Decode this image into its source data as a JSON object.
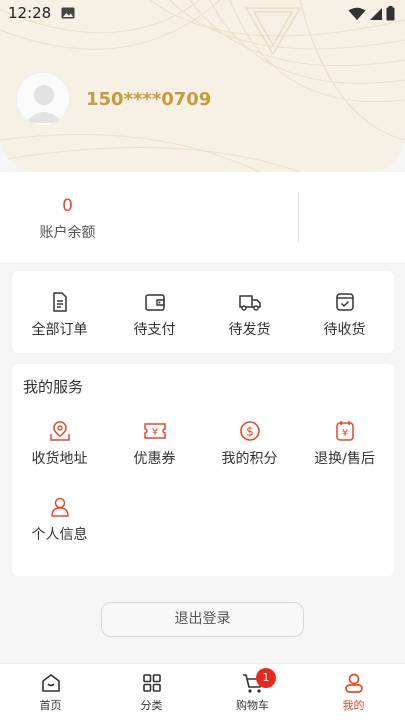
{
  "status_bar": {
    "time": "12:28"
  },
  "profile": {
    "phone": "150****0709"
  },
  "balance": {
    "value": "0",
    "label": "账户余额"
  },
  "orders": [
    {
      "label": "全部订单",
      "icon": "document-icon"
    },
    {
      "label": "待支付",
      "icon": "wallet-icon"
    },
    {
      "label": "待发货",
      "icon": "truck-icon"
    },
    {
      "label": "待收货",
      "icon": "box-check-icon"
    }
  ],
  "services": {
    "title": "我的服务",
    "items": [
      {
        "label": "收货地址",
        "icon": "map-pin-icon"
      },
      {
        "label": "优惠券",
        "icon": "coupon-icon"
      },
      {
        "label": "我的积分",
        "icon": "coin-icon"
      },
      {
        "label": "退换/售后",
        "icon": "refund-icon"
      },
      {
        "label": "个人信息",
        "icon": "user-icon"
      }
    ]
  },
  "logout_label": "退出登录",
  "tabbar": {
    "items": [
      {
        "label": "首页",
        "icon": "home-icon"
      },
      {
        "label": "分类",
        "icon": "grid-icon"
      },
      {
        "label": "购物车",
        "icon": "cart-icon"
      },
      {
        "label": "我的",
        "icon": "profile-icon"
      }
    ],
    "cart_badge": "1",
    "active_index": 3
  },
  "colors": {
    "accent": "#e8492a",
    "gold": "#c89b3c",
    "hero_bg": "#f6f1e4"
  }
}
